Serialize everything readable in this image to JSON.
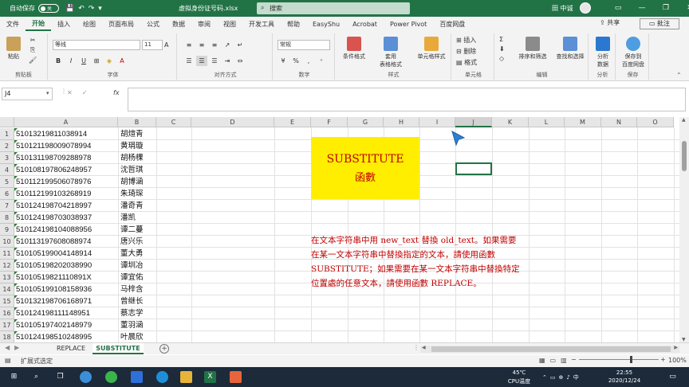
{
  "titlebar": {
    "autosave": "自动保存",
    "toggle": "关",
    "filename": "虚拟身份证号码.xlsx",
    "search_placeholder": "搜索",
    "user": "田 中诚"
  },
  "menu": {
    "tabs": [
      "文件",
      "开始",
      "插入",
      "绘图",
      "页面布局",
      "公式",
      "数据",
      "审阅",
      "视图",
      "开发工具",
      "帮助",
      "EasyShu",
      "Acrobat",
      "Power Pivot",
      "百度网盘"
    ],
    "active_index": 1,
    "share": "共享",
    "comments": "批注"
  },
  "ribbon": {
    "paste": "粘贴",
    "clipboard": "剪贴板",
    "font_name": "等线",
    "font_size": "11",
    "font_group": "字体",
    "align_group": "对齐方式",
    "number_format": "常规",
    "number_group": "数字",
    "cond_format": "条件格式",
    "table_format_1": "套用",
    "table_format_2": "表格格式",
    "cell_style": "单元格样式",
    "style_group": "样式",
    "insert": "插入",
    "delete": "删除",
    "format": "格式",
    "cells_group": "单元格",
    "sort_filter": "排序和筛选",
    "find_select": "查找和选择",
    "edit_group": "编辑",
    "analyze_1": "分析",
    "analyze_2": "数据",
    "analyze_group": "分析",
    "save_baidu_1": "保存到",
    "save_baidu_2": "百度网盘",
    "save_group": "保存"
  },
  "formula": {
    "namebox": "J4",
    "fx": "fx",
    "value": ""
  },
  "grid": {
    "columns": [
      "A",
      "B",
      "C",
      "D",
      "E",
      "F",
      "G",
      "H",
      "I",
      "J",
      "K",
      "L",
      "M",
      "N",
      "O"
    ],
    "selected_column": "J",
    "rows": [
      "1",
      "2",
      "3",
      "4",
      "5",
      "6",
      "7",
      "8",
      "9",
      "10",
      "11",
      "12",
      "13",
      "14",
      "15",
      "16",
      "17",
      "18"
    ],
    "colA": [
      "510132198110389​14",
      "510121198009078994",
      "510131198709288978",
      "510108197806248957",
      "510112199506078976",
      "510112199103268919",
      "510124198704218997",
      "510124198703038937",
      "510124198104088956",
      "510113197608088974",
      "510105199004148914",
      "510105198202038990",
      "510105198211​10891X",
      "510105199108158936",
      "510132198706168971",
      "510124198111148951",
      "510105197402148979",
      "510124198510248995"
    ],
    "colB": [
      "胡煊青",
      "黄琄璇",
      "胡杨棵",
      "沈哲琪",
      "胡博涵",
      "朱琦琛",
      "潘奇青",
      "潘凯",
      "谭二蔓",
      "唐兴乐",
      "董大勇",
      "谭圳冶",
      "谭宜佑",
      "马梓含",
      "曾继长",
      "蔡志学",
      "董羽涵",
      "叶晨欣"
    ]
  },
  "box": {
    "line1": "SUBSTITUTE",
    "line2": "函數"
  },
  "description": "在文本字符串中用 new_text 替換 old_text。如果需要在某一文本字符串中替換指定的文本，請使用函數 SUBSTITUTE；如果需要在某一文本字符串中替換特定位置處的任意文本，請使用函數 REPLACE。",
  "sheets": {
    "tabs": [
      "REPLACE",
      "SUBSTITUTE"
    ],
    "active_index": 1
  },
  "status": {
    "text": "扩展式选定",
    "zoom": "100%"
  },
  "taskbar": {
    "weather_temp": "45℃",
    "weather_label": "CPU温度",
    "time": "22:55",
    "date": "2020/12/24"
  },
  "colors": {
    "excel_green": "#217346",
    "highlight_yellow": "#ffee00",
    "text_red": "#c00000"
  }
}
